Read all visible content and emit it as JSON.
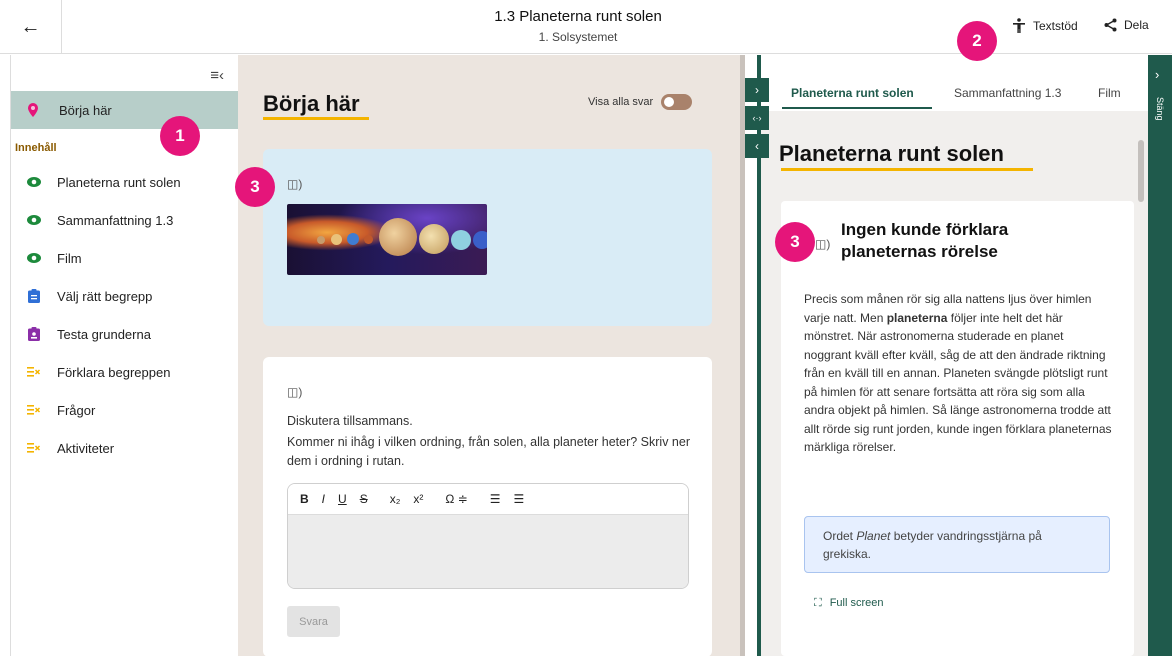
{
  "header": {
    "back_icon": "arrow-left-icon",
    "title": "1.3 Planeterna runt solen",
    "subtitle": "1. Solsystemet",
    "textstod_label": "Textstöd",
    "dela_label": "Dela"
  },
  "badges": {
    "b1": "1",
    "b2": "2",
    "b3a": "3",
    "b3b": "3"
  },
  "sidebar": {
    "start_label": "Börja här",
    "section_label": "Innehåll",
    "items": [
      {
        "label": "Planeterna runt solen",
        "icon": "eye-icon"
      },
      {
        "label": "Sammanfattning 1.3",
        "icon": "eye-icon"
      },
      {
        "label": "Film",
        "icon": "eye-icon"
      },
      {
        "label": "Välj rätt begrepp",
        "icon": "clipboard-icon"
      },
      {
        "label": "Testa grunderna",
        "icon": "test-icon"
      },
      {
        "label": "Förklara begreppen",
        "icon": "task-icon"
      },
      {
        "label": "Frågor",
        "icon": "task-icon"
      },
      {
        "label": "Aktiviteter",
        "icon": "task-icon"
      }
    ]
  },
  "main": {
    "heading": "Börja här",
    "toggle_label": "Visa alla svar",
    "card2": {
      "line1": "Diskutera tillsammans.",
      "line2": "Kommer ni ihåg i vilken ordning, från solen, alla planeter heter? Skriv ner dem i ordning i rutan."
    },
    "editor": {
      "bold": "B",
      "italic": "I",
      "underline": "U",
      "strike": "S",
      "sub": "x₂",
      "sup": "x²",
      "omega": "Ω ≑",
      "ol": "☰",
      "ul": "☰"
    },
    "submit_label": "Svara"
  },
  "panel": {
    "tabs": [
      "Planeterna runt solen",
      "Sammanfattning 1.3",
      "Film"
    ],
    "heading": "Planeterna runt solen",
    "card_title": "Ingen kunde förklara planeternas rörelse",
    "body_1": "Precis som månen rör sig alla nattens ljus över himlen varje natt. Men ",
    "body_bold": "planeterna",
    "body_2": " följer inte helt det här mönstret. När astronomerna studerade en planet noggrant kväll efter kväll, såg de att den ändrade riktning från en kväll till en annan. Planeten svängde plötsligt runt på himlen för att senare fortsätta att röra sig som alla andra objekt på himlen. Så länge astronomerna trodde att allt rörde sig runt jorden, kunde ingen förklara planeternas märkliga rörelser.",
    "info_1": "Ordet ",
    "info_italic": "Planet",
    "info_2": " betyder vandringsstjärna på grekiska.",
    "fullscreen_label": "Full screen",
    "close_label": "Stäng"
  },
  "colors": {
    "accent": "#1f5a4c",
    "badge": "#e5157a",
    "underline": "#f4b400"
  }
}
